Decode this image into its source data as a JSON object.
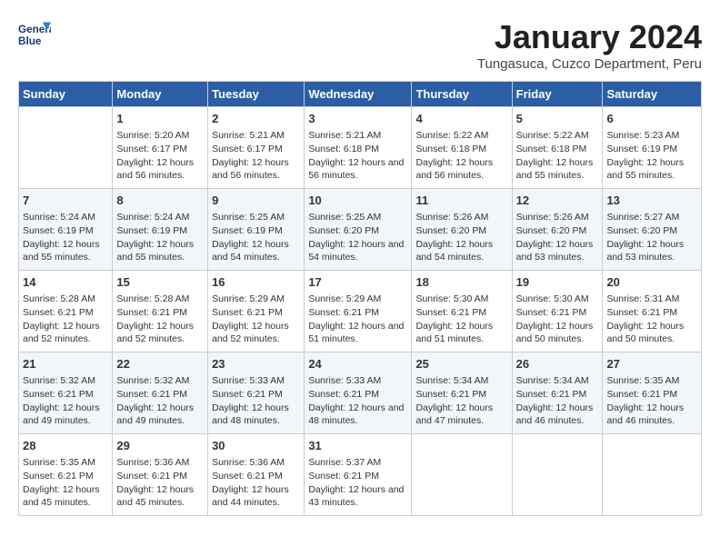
{
  "header": {
    "logo_line1": "General",
    "logo_line2": "Blue",
    "month": "January 2024",
    "location": "Tungasuca, Cuzco Department, Peru"
  },
  "weekdays": [
    "Sunday",
    "Monday",
    "Tuesday",
    "Wednesday",
    "Thursday",
    "Friday",
    "Saturday"
  ],
  "weeks": [
    [
      {
        "day": "",
        "sunrise": "",
        "sunset": "",
        "daylight": ""
      },
      {
        "day": "1",
        "sunrise": "Sunrise: 5:20 AM",
        "sunset": "Sunset: 6:17 PM",
        "daylight": "Daylight: 12 hours and 56 minutes."
      },
      {
        "day": "2",
        "sunrise": "Sunrise: 5:21 AM",
        "sunset": "Sunset: 6:17 PM",
        "daylight": "Daylight: 12 hours and 56 minutes."
      },
      {
        "day": "3",
        "sunrise": "Sunrise: 5:21 AM",
        "sunset": "Sunset: 6:18 PM",
        "daylight": "Daylight: 12 hours and 56 minutes."
      },
      {
        "day": "4",
        "sunrise": "Sunrise: 5:22 AM",
        "sunset": "Sunset: 6:18 PM",
        "daylight": "Daylight: 12 hours and 56 minutes."
      },
      {
        "day": "5",
        "sunrise": "Sunrise: 5:22 AM",
        "sunset": "Sunset: 6:18 PM",
        "daylight": "Daylight: 12 hours and 55 minutes."
      },
      {
        "day": "6",
        "sunrise": "Sunrise: 5:23 AM",
        "sunset": "Sunset: 6:19 PM",
        "daylight": "Daylight: 12 hours and 55 minutes."
      }
    ],
    [
      {
        "day": "7",
        "sunrise": "Sunrise: 5:24 AM",
        "sunset": "Sunset: 6:19 PM",
        "daylight": "Daylight: 12 hours and 55 minutes."
      },
      {
        "day": "8",
        "sunrise": "Sunrise: 5:24 AM",
        "sunset": "Sunset: 6:19 PM",
        "daylight": "Daylight: 12 hours and 55 minutes."
      },
      {
        "day": "9",
        "sunrise": "Sunrise: 5:25 AM",
        "sunset": "Sunset: 6:19 PM",
        "daylight": "Daylight: 12 hours and 54 minutes."
      },
      {
        "day": "10",
        "sunrise": "Sunrise: 5:25 AM",
        "sunset": "Sunset: 6:20 PM",
        "daylight": "Daylight: 12 hours and 54 minutes."
      },
      {
        "day": "11",
        "sunrise": "Sunrise: 5:26 AM",
        "sunset": "Sunset: 6:20 PM",
        "daylight": "Daylight: 12 hours and 54 minutes."
      },
      {
        "day": "12",
        "sunrise": "Sunrise: 5:26 AM",
        "sunset": "Sunset: 6:20 PM",
        "daylight": "Daylight: 12 hours and 53 minutes."
      },
      {
        "day": "13",
        "sunrise": "Sunrise: 5:27 AM",
        "sunset": "Sunset: 6:20 PM",
        "daylight": "Daylight: 12 hours and 53 minutes."
      }
    ],
    [
      {
        "day": "14",
        "sunrise": "Sunrise: 5:28 AM",
        "sunset": "Sunset: 6:21 PM",
        "daylight": "Daylight: 12 hours and 52 minutes."
      },
      {
        "day": "15",
        "sunrise": "Sunrise: 5:28 AM",
        "sunset": "Sunset: 6:21 PM",
        "daylight": "Daylight: 12 hours and 52 minutes."
      },
      {
        "day": "16",
        "sunrise": "Sunrise: 5:29 AM",
        "sunset": "Sunset: 6:21 PM",
        "daylight": "Daylight: 12 hours and 52 minutes."
      },
      {
        "day": "17",
        "sunrise": "Sunrise: 5:29 AM",
        "sunset": "Sunset: 6:21 PM",
        "daylight": "Daylight: 12 hours and 51 minutes."
      },
      {
        "day": "18",
        "sunrise": "Sunrise: 5:30 AM",
        "sunset": "Sunset: 6:21 PM",
        "daylight": "Daylight: 12 hours and 51 minutes."
      },
      {
        "day": "19",
        "sunrise": "Sunrise: 5:30 AM",
        "sunset": "Sunset: 6:21 PM",
        "daylight": "Daylight: 12 hours and 50 minutes."
      },
      {
        "day": "20",
        "sunrise": "Sunrise: 5:31 AM",
        "sunset": "Sunset: 6:21 PM",
        "daylight": "Daylight: 12 hours and 50 minutes."
      }
    ],
    [
      {
        "day": "21",
        "sunrise": "Sunrise: 5:32 AM",
        "sunset": "Sunset: 6:21 PM",
        "daylight": "Daylight: 12 hours and 49 minutes."
      },
      {
        "day": "22",
        "sunrise": "Sunrise: 5:32 AM",
        "sunset": "Sunset: 6:21 PM",
        "daylight": "Daylight: 12 hours and 49 minutes."
      },
      {
        "day": "23",
        "sunrise": "Sunrise: 5:33 AM",
        "sunset": "Sunset: 6:21 PM",
        "daylight": "Daylight: 12 hours and 48 minutes."
      },
      {
        "day": "24",
        "sunrise": "Sunrise: 5:33 AM",
        "sunset": "Sunset: 6:21 PM",
        "daylight": "Daylight: 12 hours and 48 minutes."
      },
      {
        "day": "25",
        "sunrise": "Sunrise: 5:34 AM",
        "sunset": "Sunset: 6:21 PM",
        "daylight": "Daylight: 12 hours and 47 minutes."
      },
      {
        "day": "26",
        "sunrise": "Sunrise: 5:34 AM",
        "sunset": "Sunset: 6:21 PM",
        "daylight": "Daylight: 12 hours and 46 minutes."
      },
      {
        "day": "27",
        "sunrise": "Sunrise: 5:35 AM",
        "sunset": "Sunset: 6:21 PM",
        "daylight": "Daylight: 12 hours and 46 minutes."
      }
    ],
    [
      {
        "day": "28",
        "sunrise": "Sunrise: 5:35 AM",
        "sunset": "Sunset: 6:21 PM",
        "daylight": "Daylight: 12 hours and 45 minutes."
      },
      {
        "day": "29",
        "sunrise": "Sunrise: 5:36 AM",
        "sunset": "Sunset: 6:21 PM",
        "daylight": "Daylight: 12 hours and 45 minutes."
      },
      {
        "day": "30",
        "sunrise": "Sunrise: 5:36 AM",
        "sunset": "Sunset: 6:21 PM",
        "daylight": "Daylight: 12 hours and 44 minutes."
      },
      {
        "day": "31",
        "sunrise": "Sunrise: 5:37 AM",
        "sunset": "Sunset: 6:21 PM",
        "daylight": "Daylight: 12 hours and 43 minutes."
      },
      {
        "day": "",
        "sunrise": "",
        "sunset": "",
        "daylight": ""
      },
      {
        "day": "",
        "sunrise": "",
        "sunset": "",
        "daylight": ""
      },
      {
        "day": "",
        "sunrise": "",
        "sunset": "",
        "daylight": ""
      }
    ]
  ]
}
